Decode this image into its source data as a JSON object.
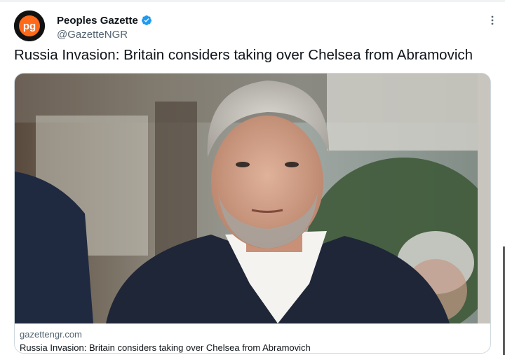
{
  "author": {
    "display_name": "Peoples Gazette",
    "handle": "@GazetteNGR",
    "verified": true,
    "avatar_icon": "pg-logo",
    "brand_color": "#ff6a1a"
  },
  "tweet": {
    "text": "Russia Invasion: Britain considers taking over Chelsea from Abramovich"
  },
  "link_card": {
    "domain": "gazettengr.com",
    "title": "Russia Invasion: Britain considers taking over Chelsea from Abramovich"
  },
  "colors": {
    "verified_blue": "#1d9bf0",
    "secondary_text": "#536471",
    "border": "#cfd9de"
  }
}
